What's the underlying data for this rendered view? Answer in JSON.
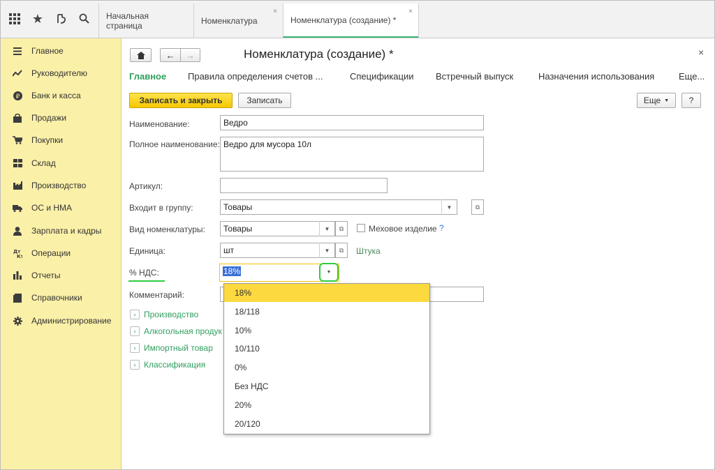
{
  "topbar": {
    "tabs": [
      {
        "label": "Начальная страница"
      },
      {
        "label": "Номенклатура",
        "close": "×"
      },
      {
        "label": "Номенклатура (создание) *",
        "close": "×"
      }
    ]
  },
  "sidebar": {
    "items": [
      {
        "label": "Главное",
        "icon": "menu-icon"
      },
      {
        "label": "Руководителю",
        "icon": "trend-icon"
      },
      {
        "label": "Банк и касса",
        "icon": "ruble-icon"
      },
      {
        "label": "Продажи",
        "icon": "bag-icon"
      },
      {
        "label": "Покупки",
        "icon": "cart-icon"
      },
      {
        "label": "Склад",
        "icon": "grid-icon"
      },
      {
        "label": "Производство",
        "icon": "factory-icon"
      },
      {
        "label": "ОС и НМА",
        "icon": "truck-icon"
      },
      {
        "label": "Зарплата и кадры",
        "icon": "person-icon"
      },
      {
        "label": "Операции",
        "icon": "operations-icon"
      },
      {
        "label": "Отчеты",
        "icon": "bar-chart-icon"
      },
      {
        "label": "Справочники",
        "icon": "book-icon"
      },
      {
        "label": "Администрирование",
        "icon": "gear-icon"
      }
    ]
  },
  "form": {
    "title": "Номенклатура (создание) *",
    "close": "×",
    "tabs": [
      "Главное",
      "Правила определения счетов ...",
      "Спецификации",
      "Встречный выпуск",
      "Назначения использования",
      "Еще..."
    ],
    "save_close": "Записать и закрыть",
    "save": "Записать",
    "more": "Еще",
    "help": "?",
    "fields": {
      "name_label": "Наименование:",
      "name_value": "Ведро",
      "fullname_label": "Полное наименование:",
      "fullname_value": "Ведро для мусора 10л",
      "article_label": "Артикул:",
      "article_value": "",
      "group_label": "Входит в группу:",
      "group_value": "Товары",
      "kind_label": "Вид номенклатуры:",
      "kind_value": "Товары",
      "fur_label": "Меховое изделие",
      "fur_help": "?",
      "unit_label": "Единица:",
      "unit_value": "шт",
      "unit_hint": "Штука",
      "vat_label": "% НДС:",
      "vat_value": "18%",
      "comment_label": "Комментарий:"
    },
    "groups": [
      "Производство",
      "Алкогольная продук",
      "Импортный товар",
      "Классификация"
    ]
  },
  "vat_dropdown": {
    "options": [
      "18%",
      "18/118",
      "10%",
      "10/110",
      "0%",
      "Без НДС",
      "20%",
      "20/120"
    ],
    "selected": "18%"
  },
  "colors": {
    "accent": "#2f9e5e",
    "sidebar": "#fbf0a8",
    "highlight": "#fbd93f",
    "annotation": "#2ecc40"
  }
}
